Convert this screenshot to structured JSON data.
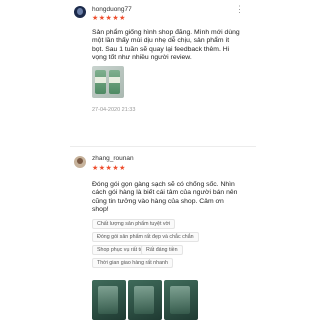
{
  "reviews": [
    {
      "username": "hongduong77",
      "stars": "★★★★★",
      "comment": "Sản phẩm giống hình shop đăng. Mình mới dùng một lần thấy mùi dịu nhẹ dễ chịu, sản phẩm ít bọt. Sau 1 tuần sẽ quay lại feedback thêm. Hi vọng tốt như nhiều người review.",
      "date": "27-04-2020 21:33",
      "rating": 5
    },
    {
      "username": "zhang_rounan",
      "stars": "★★★★★",
      "comment": "Đóng gói gọn gàng sạch sẽ có chống sốc. Nhìn cách gói hàng là biết cái tâm của người bán nên cũng tin tưởng vào hàng của shop. Cảm ơn shop!",
      "tags": [
        "Chất lượng sản phẩm tuyệt vời",
        "Đóng gói sản phẩm rất đẹp và chắc chắn",
        "Shop phục vụ rất tốt",
        "Rất đáng tiền",
        "Thời gian giao hàng rất nhanh"
      ],
      "rating": 5
    }
  ],
  "colors": {
    "star": "#ee4d2d",
    "muted": "#999999"
  },
  "icons": {
    "more": "more-vertical-icon"
  }
}
